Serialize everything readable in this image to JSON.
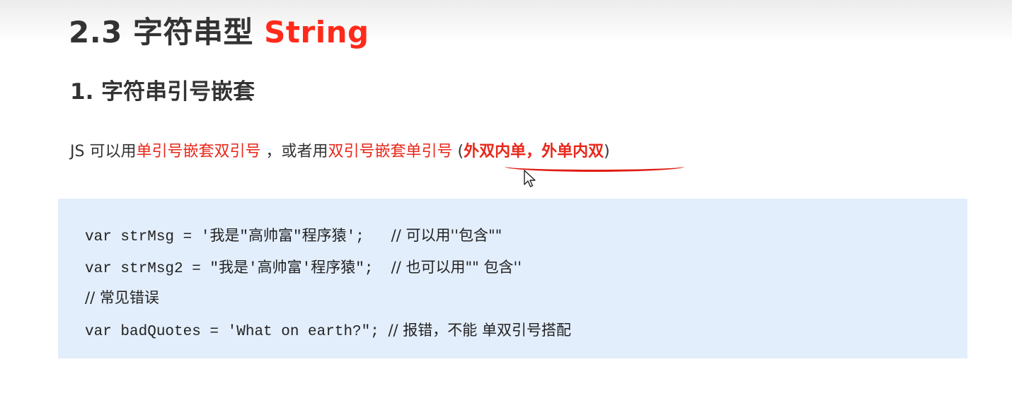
{
  "heading": {
    "prefix": "2.3 字符串型 ",
    "accent": "String"
  },
  "subheading": "1. 字符串引号嵌套",
  "description": {
    "part1": "JS 可以用",
    "red1": "单引号嵌套双引号",
    "part2": " ，或者用",
    "red2": "双引号嵌套单引号",
    "paren_open": " (",
    "highlight": "外双内单，外单内双",
    "paren_close": ")"
  },
  "code": {
    "line1": {
      "code": "var strMsg = '我是\"高帅富\"程序猿';   ",
      "comment": "// 可以用''包含\"\""
    },
    "line2": {
      "code": "var strMsg2 = \"我是'高帅富'程序猿\";  ",
      "comment": "// 也可以用\"\" 包含''"
    },
    "line3": {
      "comment": "// 常见错误"
    },
    "line4": {
      "code": "var badQuotes = 'What on earth?\"; ",
      "comment": "// 报错，不能 单双引号搭配"
    }
  },
  "colors": {
    "accent": "#ff2a1a",
    "code_bg": "#e3eefc",
    "text": "#333333"
  },
  "icons": {
    "cursor": "mouse-pointer-icon"
  }
}
